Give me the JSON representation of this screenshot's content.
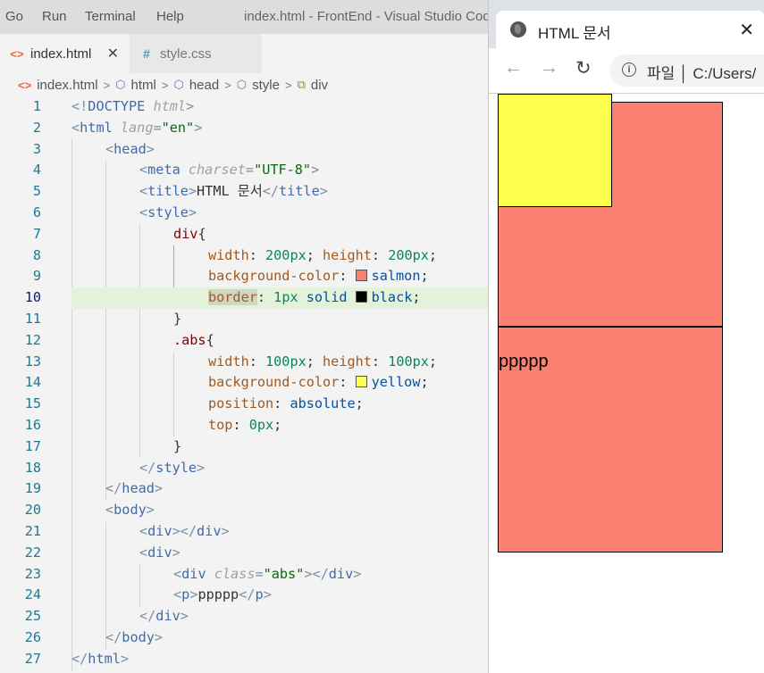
{
  "vscode": {
    "menu": [
      "Go",
      "Run",
      "Terminal",
      "Help"
    ],
    "window_title": "index.html - FrontEnd - Visual Studio Code",
    "tabs": [
      {
        "label": "index.html",
        "icon": "html-icon",
        "active": true
      },
      {
        "label": "style.css",
        "icon": "css-hash-icon",
        "active": false
      }
    ],
    "breadcrumb": [
      "index.html",
      "html",
      "head",
      "style",
      "div"
    ],
    "current_line": 10,
    "swatch_colors": {
      "salmon": "#fa8072",
      "black": "#000000",
      "yellow": "#ffff00"
    },
    "lines": [
      {
        "n": "1",
        "text": "<!DOCTYPE html>"
      },
      {
        "n": "2",
        "text": "<html lang=\"en\">"
      },
      {
        "n": "3",
        "text": "<head>"
      },
      {
        "n": "4",
        "text": "<meta charset=\"UTF-8\">"
      },
      {
        "n": "5",
        "text": "<title>HTML 문서</title>"
      },
      {
        "n": "6",
        "text": "<style>"
      },
      {
        "n": "7",
        "text": "div{"
      },
      {
        "n": "8",
        "text": "width: 200px; height: 200px;"
      },
      {
        "n": "9",
        "text": "background-color: salmon;"
      },
      {
        "n": "10",
        "text": "border: 1px solid black;"
      },
      {
        "n": "11",
        "text": "}"
      },
      {
        "n": "12",
        "text": ".abs{"
      },
      {
        "n": "13",
        "text": "width: 100px; height: 100px;"
      },
      {
        "n": "14",
        "text": "background-color: yellow;"
      },
      {
        "n": "15",
        "text": "position: absolute;"
      },
      {
        "n": "16",
        "text": "top: 0px;"
      },
      {
        "n": "17",
        "text": "}"
      },
      {
        "n": "18",
        "text": "</style>"
      },
      {
        "n": "19",
        "text": "</head>"
      },
      {
        "n": "20",
        "text": "<body>"
      },
      {
        "n": "21",
        "text": "<div></div>"
      },
      {
        "n": "22",
        "text": "<div>"
      },
      {
        "n": "23",
        "text": "<div class=\"abs\"></div>"
      },
      {
        "n": "24",
        "text": "<p>ppppp</p>"
      },
      {
        "n": "25",
        "text": "</div>"
      },
      {
        "n": "26",
        "text": "</body>"
      },
      {
        "n": "27",
        "text": "</html>"
      }
    ]
  },
  "chrome": {
    "tab_title": "HTML 문서",
    "tab_icon": "globe-icon",
    "address_label": "파일",
    "address_path": "C:/Users/",
    "page_text": "ppppp",
    "colors": {
      "box": "salmon",
      "abs": "yellow"
    }
  }
}
